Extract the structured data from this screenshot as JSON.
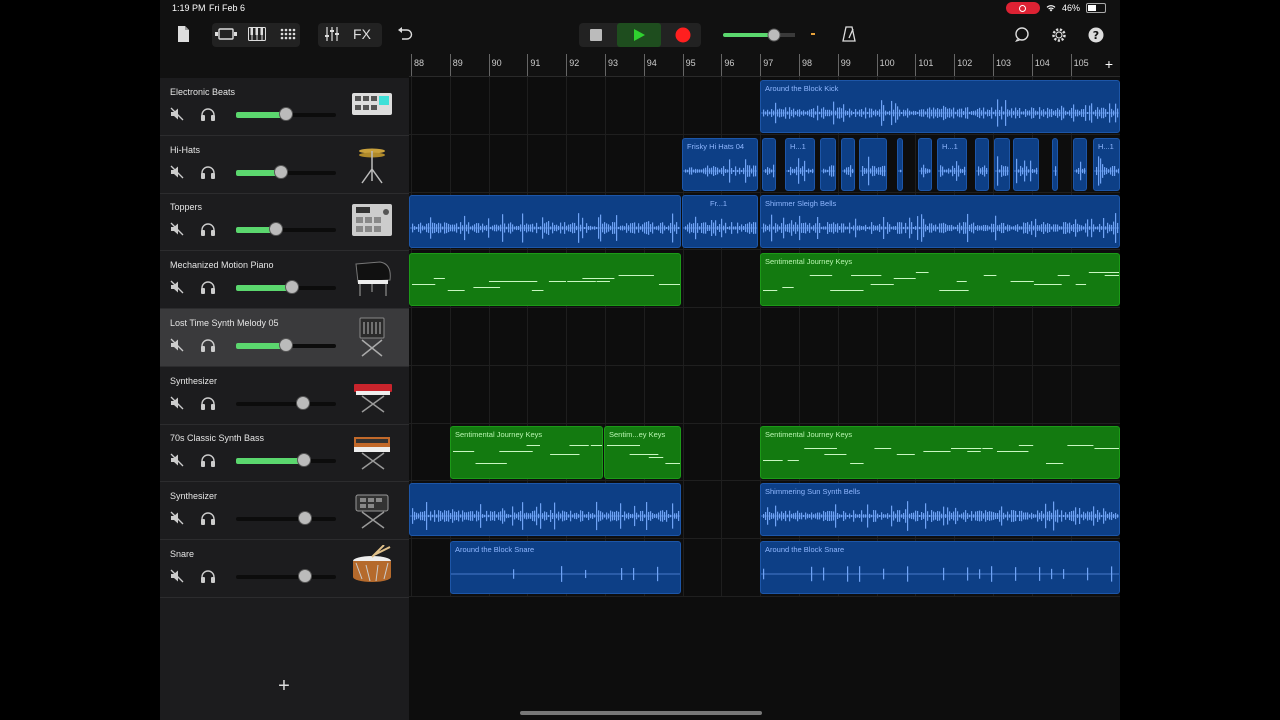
{
  "status": {
    "time": "1:19 PM",
    "date": "Fri Feb 6",
    "battery": "46%"
  },
  "toolbar": {
    "fx_label": "FX",
    "icons": [
      "document-icon",
      "tracks-view-icon",
      "keyboard-icon",
      "grid-icon",
      "mixer-icon",
      "undo-icon",
      "stop-icon",
      "play-icon",
      "record-icon",
      "master-volume-icon",
      "metronome-icon",
      "loop-browser-icon",
      "settings-icon",
      "help-icon"
    ],
    "master_volume": 0.62,
    "colors": {
      "play": "#2fd12f",
      "record": "#ff1f1f",
      "accent": "#5bd76e"
    }
  },
  "ruler": {
    "bars": [
      "88",
      "89",
      "90",
      "91",
      "92",
      "93",
      "94",
      "95",
      "96",
      "97",
      "98",
      "99",
      "100",
      "101",
      "102",
      "103",
      "104",
      "105"
    ],
    "add_label": "+"
  },
  "tracks": [
    {
      "name": "Electronic Beats",
      "volume": 0.5,
      "icon": "drum-machine-icon"
    },
    {
      "name": "Hi-Hats",
      "volume": 0.45,
      "icon": "hi-hat-icon"
    },
    {
      "name": "Toppers",
      "volume": 0.4,
      "icon": "sampler-icon"
    },
    {
      "name": "Mechanized Motion Piano",
      "volume": 0.56,
      "icon": "grand-piano-icon"
    },
    {
      "name": "Lost Time Synth Melody 05",
      "volume": 0.5,
      "icon": "synth-stand-icon",
      "selected": true
    },
    {
      "name": "Synthesizer",
      "volume": 0.67,
      "icon": "red-keyboard-icon"
    },
    {
      "name": "70s Classic Synth Bass",
      "volume": 0.68,
      "icon": "analog-synth-icon"
    },
    {
      "name": "Synthesizer",
      "volume": 0.69,
      "icon": "drum-pad-icon"
    },
    {
      "name": "Snare",
      "volume": 0.69,
      "icon": "snare-drum-icon"
    }
  ],
  "regions": {
    "r0": "Around the Block Kick",
    "r1": "Frisky Hi Hats 04",
    "r2": "H...1",
    "r3": "H...1",
    "r4": "H...1",
    "r5": "Fr...1",
    "r6": "Shimmer Sleigh Bells",
    "r7": "Sentimental Journey Keys",
    "r8": "Sentimental Journey Keys",
    "r9": "Sentim...ey Keys",
    "r10": "Sentimental Journey Keys",
    "r11": "Shimmering Sun Synth Bells",
    "r12": "Around the Block Snare",
    "r13": "Around the Block Snare"
  },
  "add_track_label": "+"
}
